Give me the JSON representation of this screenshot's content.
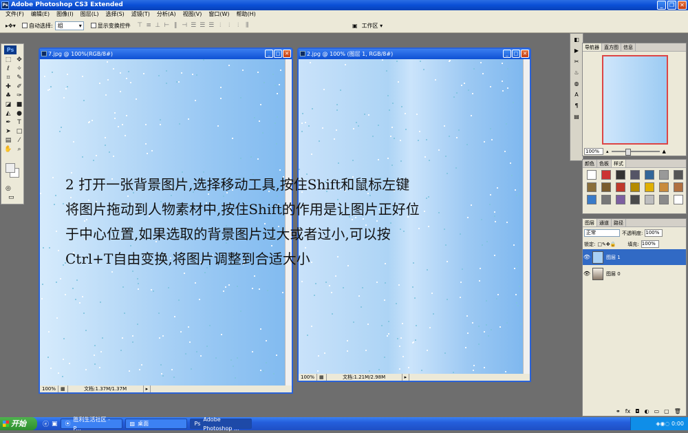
{
  "app": {
    "title": "Adobe Photoshop CS3 Extended",
    "logo": "Ps"
  },
  "menu": [
    "文件(F)",
    "编辑(E)",
    "图像(I)",
    "图层(L)",
    "选择(S)",
    "滤镜(T)",
    "分析(A)",
    "视图(V)",
    "窗口(W)",
    "帮助(H)"
  ],
  "options": {
    "auto_select_label": "自动选择:",
    "auto_select_value": "组",
    "show_transform_label": "显示变换控件",
    "workspace_label": "工作区 ▾"
  },
  "doc1": {
    "title": "7.jpg @ 100%(RGB/8#)",
    "zoom": "100%",
    "status": "文档:1.37M/1.37M"
  },
  "doc2": {
    "title": "2.jpg @ 100% (图层 1, RGB/8#)",
    "zoom": "100%",
    "status": "文档:1.21M/2.98M"
  },
  "navigator": {
    "tabs": [
      "导航器",
      "直方图",
      "信息"
    ],
    "zoom": "100%"
  },
  "styles": {
    "tabs": [
      "颜色",
      "色板",
      "样式"
    ],
    "colors": [
      "#ffffff",
      "#c33",
      "#333",
      "#556",
      "#336699",
      "#999",
      "#555",
      "#8b6f3a",
      "#7a5c2e",
      "#c0392b",
      "#b58b00",
      "#e0b000",
      "#c98b3c",
      "#b07040",
      "#3a7bc8",
      "#777",
      "#7d5fa0",
      "#4a4a4a",
      "#bdbdbd",
      "#8a8a8a",
      "#ffffff"
    ]
  },
  "layers": {
    "tabs": [
      "图层",
      "通道",
      "路径"
    ],
    "blend_mode": "正常",
    "opacity_label": "不透明度:",
    "opacity": "100%",
    "lock_label": "锁定:",
    "fill_label": "填充:",
    "fill": "100%",
    "items": [
      {
        "name": "图层 1"
      },
      {
        "name": "图层 0"
      }
    ]
  },
  "tutorial_text": "2 打开一张背景图片,选择移动工具,按住Shift和鼠标左键\n将图片拖动到人物素材中,按住Shift的作用是让图片正好位\n于中心位置,如果选取的背景图片过大或者过小,可以按\nCtrl+T自由变换,将图片调整到合适大小",
  "taskbar": {
    "start": "开始",
    "items": [
      "胜利生活社区 - P...",
      "桌面",
      "Adobe Photoshop ..."
    ],
    "clock": "0:00"
  }
}
